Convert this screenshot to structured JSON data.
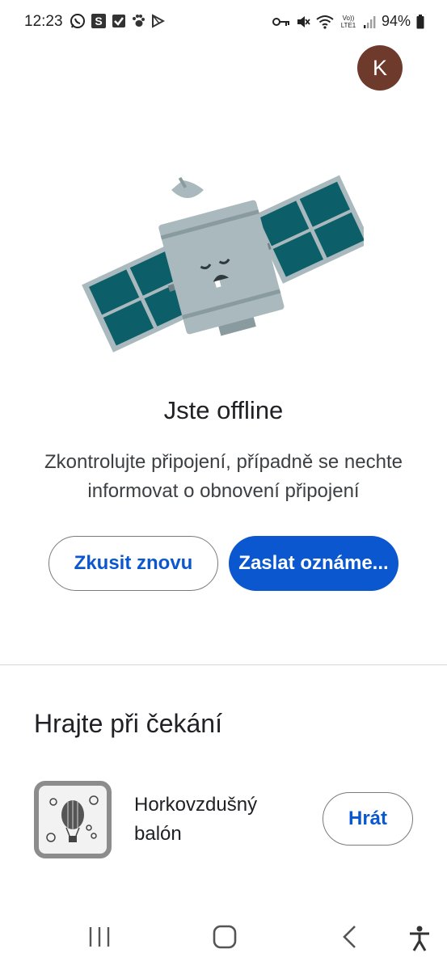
{
  "status_bar": {
    "time": "12:23",
    "left_icons": [
      "whatsapp-icon",
      "s-app-icon",
      "checkbox-icon",
      "paw-icon",
      "play-store-icon"
    ],
    "right_icons": [
      "vpn-key-icon",
      "mute-icon",
      "wifi-icon",
      "volte-icon",
      "signal-icon",
      "battery-icon"
    ],
    "volte_text": "Vo)) LTE1",
    "battery": "94%"
  },
  "account": {
    "avatar_letter": "K",
    "avatar_color": "#6d3a2c"
  },
  "offline": {
    "title": "Jste offline",
    "description": "Zkontrolujte připojení, případně se nechte informovat o obnovení připojení"
  },
  "buttons": {
    "retry_label": "Zkusit znovu",
    "notify_label": "Zaslat oznáme..."
  },
  "games": {
    "section_title": "Hrajte při čekání",
    "items": [
      {
        "name": "Horkovzdušný balón",
        "icon": "hot-air-balloon-icon",
        "play_label": "Hrát"
      }
    ]
  },
  "colors": {
    "accent": "#0b57d0",
    "panel": "#0c5f68",
    "satellite_body": "#a9b9bd"
  },
  "nav_bar": [
    "recent-apps-icon",
    "home-icon",
    "back-icon",
    "accessibility-icon"
  ]
}
